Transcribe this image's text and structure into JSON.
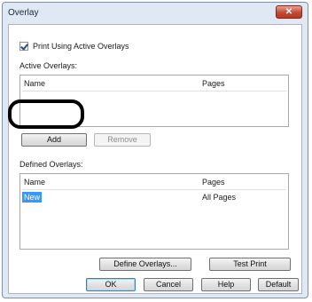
{
  "window": {
    "title": "Overlay",
    "close_glyph": "✕"
  },
  "print_using": {
    "label": "Print Using Active Overlays",
    "checked": true
  },
  "active_overlays": {
    "label": "Active Overlays:",
    "columns": [
      "Name",
      "Pages"
    ],
    "rows": []
  },
  "buttons": {
    "add": "Add",
    "remove": "Remove",
    "define_overlays": "Define Overlays...",
    "test_print": "Test Print",
    "ok": "OK",
    "cancel": "Cancel",
    "help": "Help",
    "default": "Default"
  },
  "defined_overlays": {
    "label": "Defined Overlays:",
    "columns": [
      "Name",
      "Pages"
    ],
    "rows": [
      {
        "name": "New",
        "pages": "All Pages"
      }
    ]
  },
  "colors": {
    "selection": "#3399ff",
    "close_button": "#c34a35",
    "highlight_ring": "#000000"
  }
}
